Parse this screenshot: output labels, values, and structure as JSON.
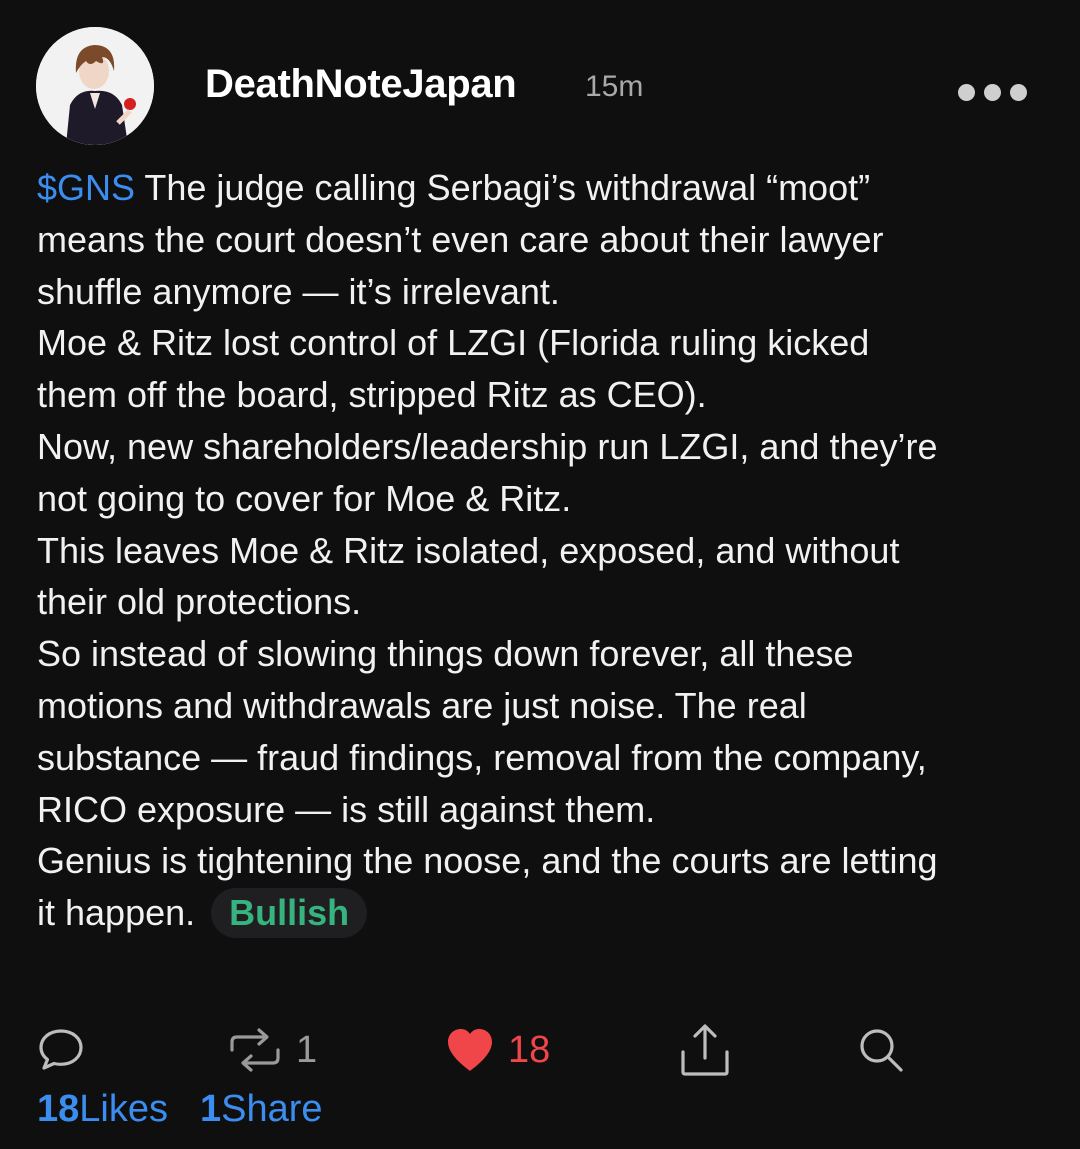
{
  "post": {
    "author": {
      "username": "DeathNoteJapan",
      "timestamp": "15m",
      "avatar_icon": "anime-character-avatar"
    },
    "more_icon": "more-horizontal-icon",
    "ticker": "$GNS",
    "lines": [
      " The judge calling Serbagi’s withdrawal “moot”",
      "means the court doesn’t even care about their lawyer",
      "shuffle anymore — it’s irrelevant.",
      "Moe & Ritz lost control of LZGI (Florida ruling kicked",
      "them off the board, stripped Ritz as CEO).",
      "Now, new shareholders/leadership run LZGI, and they’re",
      "not going to cover for Moe & Ritz.",
      "This leaves Moe & Ritz isolated, exposed, and without",
      "their old protections.",
      "So instead of slowing things down forever, all these",
      "motions and withdrawals are just noise. The real",
      "substance — fraud findings, removal from the company,",
      "RICO exposure — is still against them.",
      "Genius is tightening the noose, and the courts are letting",
      "it happen."
    ],
    "sentiment_badge": "Bullish",
    "colors": {
      "background": "#0f0f10",
      "ticker": "#3b8ef0",
      "bullish": "#36b37e",
      "like": "#f0464a"
    }
  },
  "actions": {
    "comment": {
      "icon": "comment-bubble-icon"
    },
    "repost": {
      "icon": "repost-icon",
      "count": "1"
    },
    "like": {
      "icon": "heart-icon",
      "count": "18"
    },
    "share": {
      "icon": "share-upload-icon"
    },
    "search": {
      "icon": "search-icon"
    }
  },
  "stats": {
    "likes_count": "18",
    "likes_label": "Likes",
    "shares_count": "1",
    "shares_label": "Share"
  }
}
